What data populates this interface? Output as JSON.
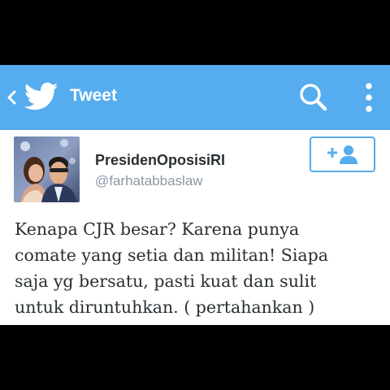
{
  "action_bar": {
    "title": "Tweet",
    "background": "#55acee",
    "icons": [
      "chevron-left-icon",
      "twitter-bird-icon",
      "search-icon",
      "overflow-menu-icon"
    ]
  },
  "tweet": {
    "author_name": "PresidenOposisiRI",
    "author_handle": "@farhatabbaslaw",
    "follow_icon": "add-user-icon",
    "text_lines": [
      "Kenapa CJR besar? Karena punya",
      "comate yang setia dan militan! Siapa",
      "saja yg bersatu, pasti kuat dan sulit",
      "untuk diruntuhkan. ( pertahankan )"
    ]
  }
}
